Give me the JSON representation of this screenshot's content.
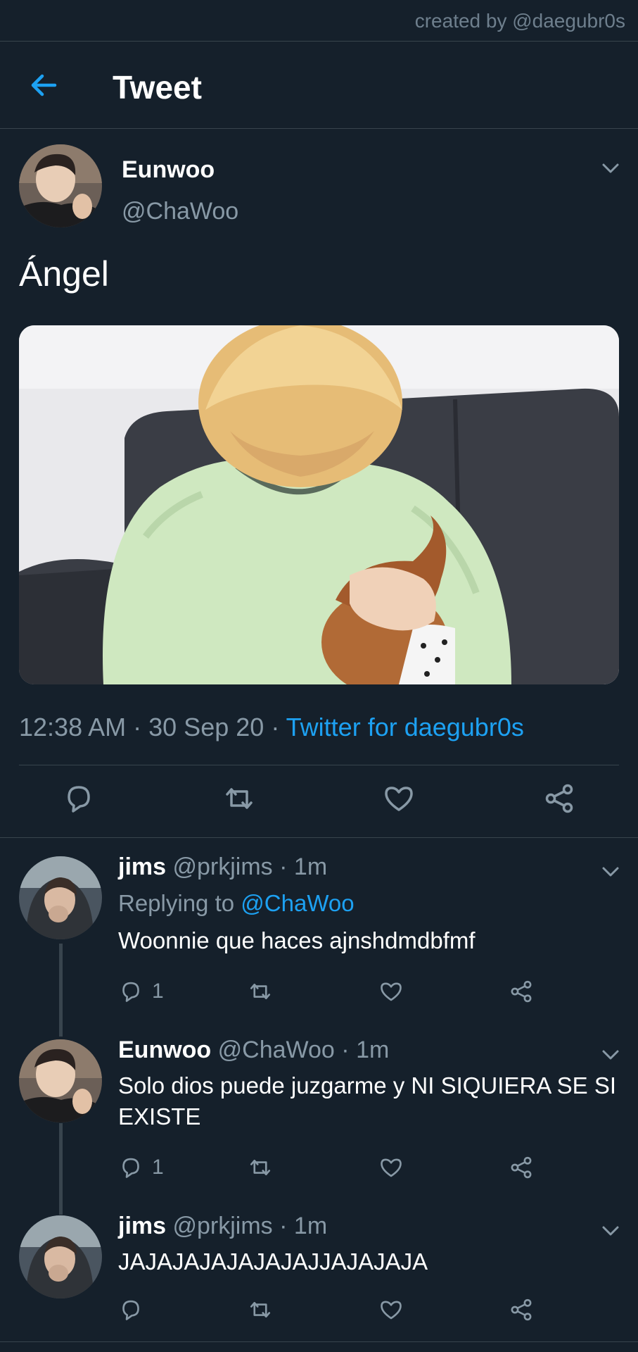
{
  "credit": "created by @daegubr0s",
  "header": {
    "title": "Tweet"
  },
  "tweet": {
    "name": "Eunwoo",
    "handle": "@ChaWoo",
    "text": "Ángel",
    "time": "12:38 AM",
    "date": "30 Sep 20",
    "source": "Twitter for daegubr0s",
    "separator": "·"
  },
  "replies": [
    {
      "name": "jims",
      "handle": "@prkjims",
      "time": "1m",
      "replying_prefix": "Replying to",
      "replying_handle": "@ChaWoo",
      "text": "Woonnie que haces ajnshdmdbfmf",
      "reply_count": "1"
    },
    {
      "name": "Eunwoo",
      "handle": "@ChaWoo",
      "time": "1m",
      "text": "Solo dios puede juzgarme y NI SIQUIERA SE SI EXISTE",
      "reply_count": "1"
    },
    {
      "name": "jims",
      "handle": "@prkjims",
      "time": "1m",
      "text": "JAJAJAJAJAJAJAJJAJAJAJA",
      "reply_count": ""
    }
  ],
  "colors": {
    "background": "#15202b",
    "accent": "#1da1f2",
    "muted": "#8899a6",
    "divider": "#38444d"
  },
  "icons": [
    "back-arrow-icon",
    "chevron-down-icon",
    "reply-icon",
    "retweet-icon",
    "like-icon",
    "share-icon"
  ]
}
